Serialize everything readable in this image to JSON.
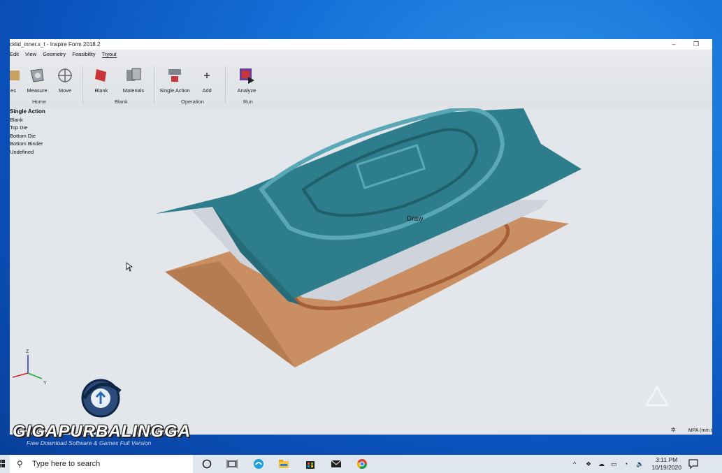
{
  "window": {
    "title": "cklid_inner.x_t - Inspire Form 2018.2",
    "minimize": "–",
    "maximize": "❐"
  },
  "menu": [
    "Edit",
    "View",
    "Geometry",
    "Feasibility",
    "Tryout"
  ],
  "ribbon": {
    "partial_label": "es",
    "home_buttons": [
      "Measure",
      "Move"
    ],
    "home_group": "Home",
    "blank_buttons": [
      "Blank",
      "Materials"
    ],
    "blank_group": "Blank",
    "operation_buttons": [
      "Single Action",
      "Add"
    ],
    "operation_group": "Operation",
    "run_buttons": [
      "Analyze"
    ],
    "run_group": "Run"
  },
  "tree": {
    "header": "Single Action",
    "items": [
      "Blank",
      "Top Die",
      "Bottom Die",
      "Bottom Binder",
      "Undefined"
    ]
  },
  "viewport": {
    "label": "Draw",
    "axis_z": "Z",
    "axis_y": "Y",
    "status": "MPA (mm t"
  },
  "watermark": {
    "title": "GIGAPURBALINGGA",
    "subtitle": "Free Download Software & Games Full Version"
  },
  "taskbar": {
    "search_placeholder": "Type here to search",
    "time": "3:11 PM",
    "date": "10/19/2020"
  },
  "colors": {
    "die": "#2e7d8c",
    "blank": "#cfd4dc",
    "binder": "#c98f63"
  }
}
